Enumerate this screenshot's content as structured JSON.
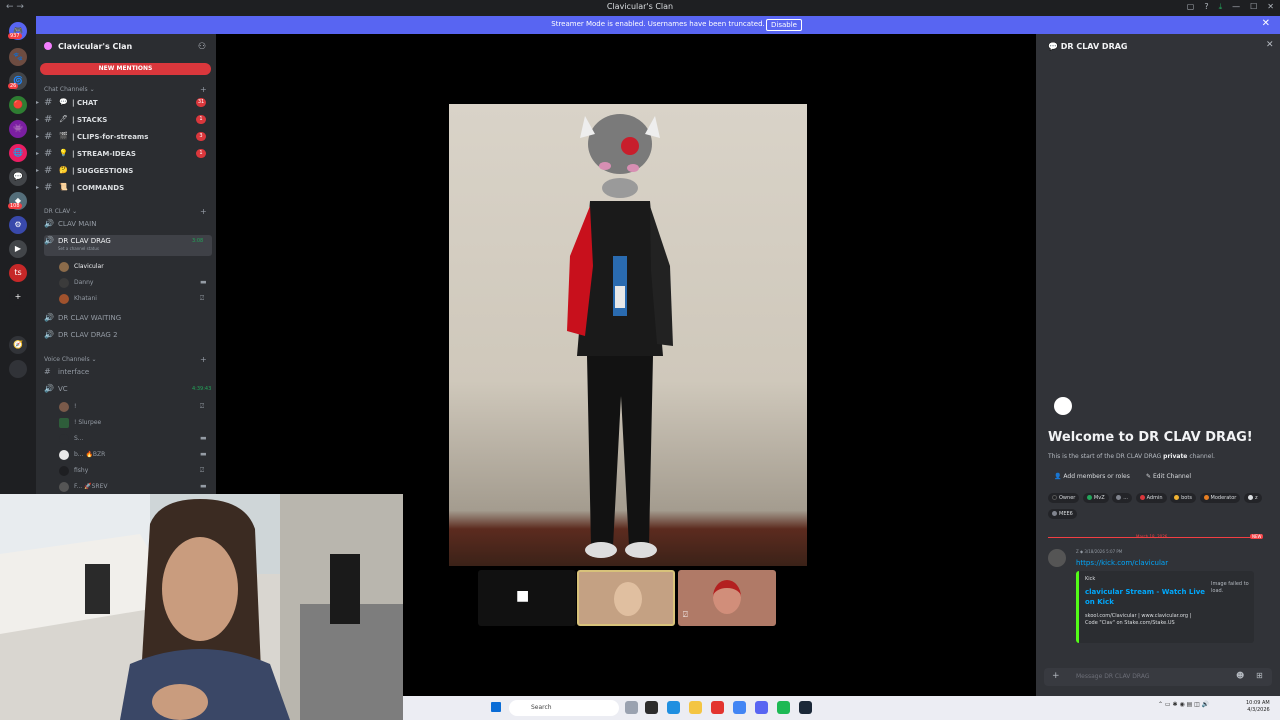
{
  "window": {
    "title": "Clavicular's Clan",
    "controls": [
      "—",
      "☐",
      "✕"
    ]
  },
  "banner": {
    "message": "Streamer Mode is enabled. Usernames have been truncated.",
    "disable_label": "Disable"
  },
  "servers": {
    "top_badge": "937",
    "badges": [
      "26",
      "108"
    ],
    "items": [
      "🎮",
      "🐾",
      "🌀",
      "🔴",
      "👾",
      "🌐",
      "💬",
      "◆",
      "⚙",
      "▶",
      "ts",
      "+",
      "🧭"
    ]
  },
  "sidebar": {
    "guild_name": "Clavicular's Clan",
    "new_mentions": "NEW MENTIONS",
    "chat_category": "Chat Channels",
    "chat_channels": [
      {
        "emoji": "💬",
        "name": "| CHAT",
        "badge": "31"
      },
      {
        "emoji": "🖊",
        "name": "| STACKS",
        "badge": "1"
      },
      {
        "emoji": "🎬",
        "name": "| CLIPS-for-streams",
        "badge": "3"
      },
      {
        "emoji": "💡",
        "name": "| STREAM-IDEAS",
        "badge": "1"
      },
      {
        "emoji": "🤔",
        "name": "| SUGGESTIONS",
        "badge": ""
      },
      {
        "emoji": "📜",
        "name": "| COMMANDS",
        "badge": ""
      }
    ],
    "drclav_category": "DR CLAV",
    "drclav_channels": [
      {
        "name": "CLAV MAIN",
        "time": "",
        "status": ""
      },
      {
        "name": "DR CLAV DRAG",
        "time": "3:08",
        "status": "Set a channel status"
      }
    ],
    "drag_users": [
      {
        "name": "Clavicular",
        "icon": ""
      },
      {
        "name": "Danny",
        "icon": "▬"
      },
      {
        "name": "Khatani",
        "icon": "⍁"
      }
    ],
    "more_channels": [
      {
        "name": "DR CLAV WAITING"
      },
      {
        "name": "DR CLAV DRAG 2"
      }
    ],
    "voice_category": "Voice Channels",
    "interface_channel": "interface",
    "vc": {
      "name": "VC",
      "time": "4:39:43"
    },
    "vc_users": [
      {
        "name": "!",
        "icon": "⍁"
      },
      {
        "name": "! Slurpee",
        "icon": ""
      },
      {
        "name": "S...",
        "icon": "▬"
      },
      {
        "name": "b... 🔥BZR",
        "icon": "▬"
      },
      {
        "name": "fishy",
        "icon": "⍁"
      },
      {
        "name": "F... 🚀SREV",
        "icon": "▬"
      }
    ]
  },
  "call": {
    "tiles": [
      "camera-off",
      "participant-a",
      "participant-b"
    ]
  },
  "right_panel": {
    "channel_name": "DR CLAV DRAG",
    "welcome_title": "Welcome to DR CLAV DRAG!",
    "welcome_sub_pre": "This is the start of the DR CLAV DRAG",
    "welcome_sub_bold": "private",
    "welcome_sub_post": "channel.",
    "add_members": "Add members or roles",
    "edit_channel": "Edit Channel",
    "roles": [
      {
        "name": "Owner",
        "color": "#1e1f22"
      },
      {
        "name": "MvZ",
        "color": "#23a55a"
      },
      {
        "name": "...",
        "color": "#80848e"
      },
      {
        "name": "Admin",
        "color": "#da373c"
      },
      {
        "name": "bots",
        "color": "#f0b232"
      },
      {
        "name": "Moderator",
        "color": "#e67e22"
      },
      {
        "name": "z",
        "color": "#dbdee1"
      },
      {
        "name": "MEE6",
        "color": "#80848e"
      }
    ],
    "divider_date": "March 18, 2026",
    "new_label": "NEW",
    "message": {
      "meta": "Z ◆ 3/18/2026 5:07 PM",
      "link": "https://kick.com/clavicular",
      "embed_provider": "Kick",
      "embed_title": "clavicular Stream - Watch Live on Kick",
      "embed_image_failed": "Image failed to load.",
      "embed_desc": "skool.com/Clavicular | www.clavicular.org | Code \"Clav\" on Stake.com/Stake.US"
    },
    "composer_placeholder": "Message DR CLAV DRAG"
  },
  "taskbar": {
    "search_label": "Search",
    "clock_time": "10:09 AM",
    "clock_date": "4/3/2026"
  }
}
